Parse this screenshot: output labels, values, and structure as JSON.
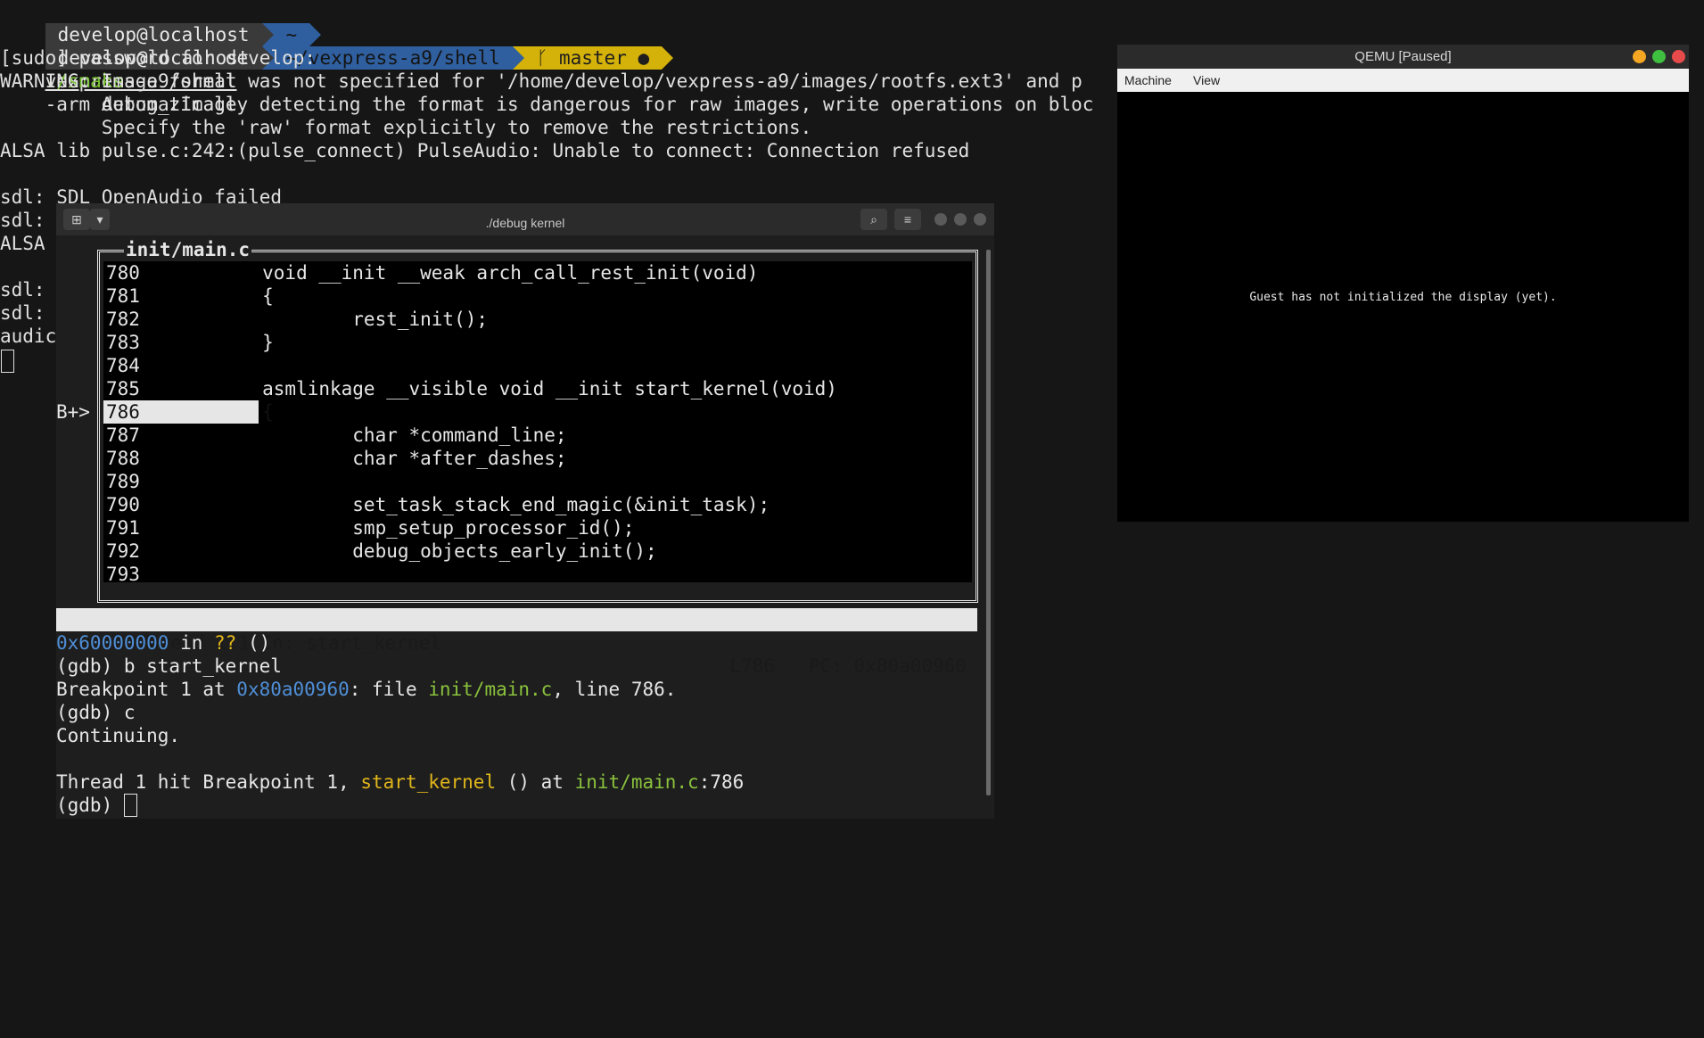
{
  "bg_terminal": {
    "prompt1": {
      "user": "develop@localhost",
      "dir": "~",
      "cmd": "cd",
      "arg": "vexpress-a9/shell"
    },
    "prompt2": {
      "user": "develop@localhost",
      "dir": "~/vexpress-a9/shell",
      "branch_icon": "ᚴ",
      "branch": "master",
      "dirty": "●",
      "cmd": "./smake",
      "args": "-arm debug_zImage"
    },
    "lines": [
      "[sudo] password for develop:",
      "WARNING: Image format was not specified for '/home/develop/vexpress-a9/images/rootfs.ext3' and p",
      "         Automatically detecting the format is dangerous for raw images, write operations on bloc",
      "         Specify the 'raw' format explicitly to remove the restrictions.",
      "ALSA lib pulse.c:242:(pulse_connect) PulseAudio: Unable to connect: Connection refused",
      "",
      "sdl: SDL_OpenAudio failed",
      "sdl:",
      "ALSA",
      "",
      "sdl:",
      "sdl:",
      "audic"
    ]
  },
  "gdb_window": {
    "title": "./debug kernel",
    "new_tab_icon": "⊞",
    "dropdown_icon": "▾",
    "search_icon": "⌕",
    "menu_icon": "≡",
    "source_title": "init/main.c",
    "breakpoint_marker": "B+>",
    "source_lines": [
      {
        "num": "780",
        "code": "        void __init __weak arch_call_rest_init(void)"
      },
      {
        "num": "781",
        "code": "        {"
      },
      {
        "num": "782",
        "code": "                rest_init();"
      },
      {
        "num": "783",
        "code": "        }"
      },
      {
        "num": "784",
        "code": ""
      },
      {
        "num": "785",
        "code": "        asmlinkage __visible void __init start_kernel(void)"
      },
      {
        "num": "786",
        "code": "        {"
      },
      {
        "num": "787",
        "code": "                char *command_line;"
      },
      {
        "num": "788",
        "code": "                char *after_dashes;"
      },
      {
        "num": "789",
        "code": ""
      },
      {
        "num": "790",
        "code": "                set_task_stack_end_magic(&init_task);"
      },
      {
        "num": "791",
        "code": "                smp_setup_processor_id();"
      },
      {
        "num": "792",
        "code": "                debug_objects_early_init();"
      },
      {
        "num": "793",
        "code": ""
      }
    ],
    "status_left": "remote Thread 1.1 In: start_kernel",
    "status_right": "L786   PC: 0x80a00960",
    "console": {
      "l1_addr": "0x60000000",
      "l1_in": " in ",
      "l1_q": "??",
      "l1_end": " ()",
      "l2": "(gdb) b start_kernel",
      "l3_a": "Breakpoint 1 at ",
      "l3_addr": "0x80a00960",
      "l3_b": ": file ",
      "l3_file": "init/main.c",
      "l3_c": ", line 786.",
      "l4": "(gdb) c",
      "l5": "Continuing.",
      "l7_a": "Thread 1 hit Breakpoint 1, ",
      "l7_fn": "start_kernel",
      "l7_b": " () at ",
      "l7_file": "init/main.c",
      "l7_c": ":786",
      "l8": "(gdb) "
    }
  },
  "qemu_window": {
    "title": "QEMU [Paused]",
    "menu": [
      "Machine",
      "View"
    ],
    "message": "Guest has not initialized the display (yet).",
    "colors": {
      "minimize": "#f5a623",
      "maximize": "#3fbf3f",
      "close": "#e64a4a"
    }
  }
}
